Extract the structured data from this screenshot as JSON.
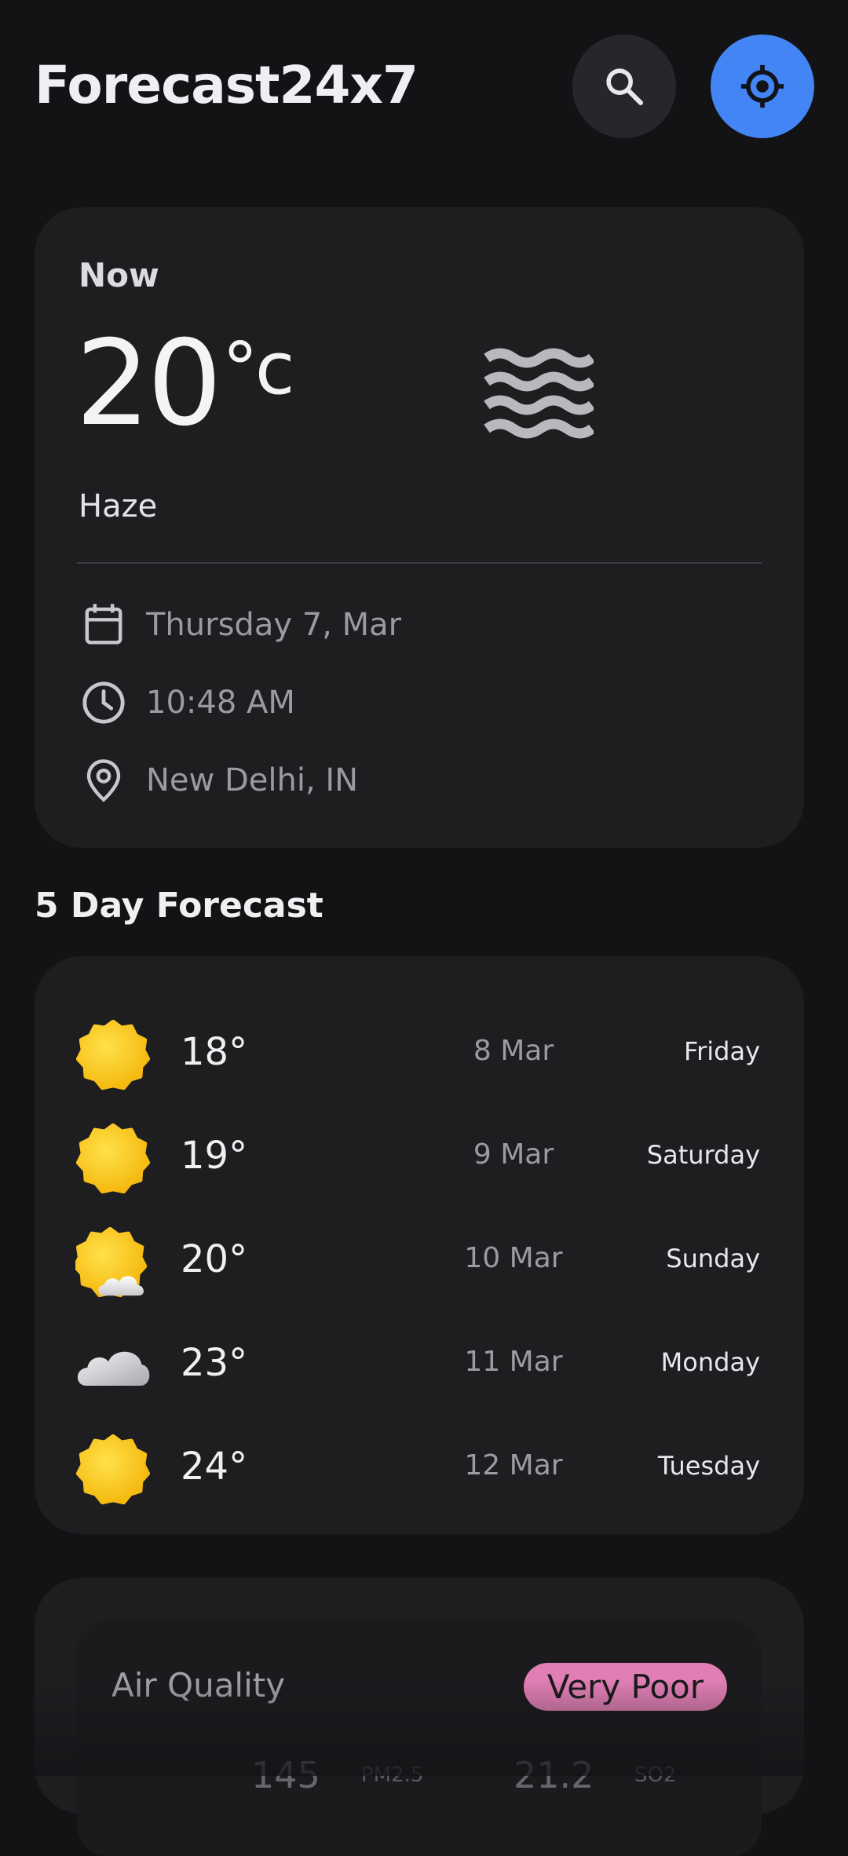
{
  "header": {
    "app_title": "Forecast24x7",
    "search_icon": "search-icon",
    "locate_icon": "my-location-icon",
    "accent_color": "#4385f4"
  },
  "now": {
    "label": "Now",
    "temperature": "20",
    "unit": "°c",
    "condition": "Haze",
    "condition_icon": "haze-icon",
    "date": "Thursday 7, Mar",
    "time": "10:48 AM",
    "location": "New Delhi, IN"
  },
  "forecast": {
    "title": "5 Day Forecast",
    "days": [
      {
        "temp": "18°",
        "date": "8 Mar",
        "day": "Friday",
        "icon": "sun-icon"
      },
      {
        "temp": "19°",
        "date": "9 Mar",
        "day": "Saturday",
        "icon": "sun-icon"
      },
      {
        "temp": "20°",
        "date": "10 Mar",
        "day": "Sunday",
        "icon": "partly-cloudy-icon"
      },
      {
        "temp": "23°",
        "date": "11 Mar",
        "day": "Monday",
        "icon": "cloud-icon"
      },
      {
        "temp": "24°",
        "date": "12 Mar",
        "day": "Tuesday",
        "icon": "sun-icon"
      }
    ]
  },
  "air_quality": {
    "title": "Air Quality",
    "status": "Very Poor",
    "status_color": "#e17fb4",
    "pm25_value": "145",
    "pm25_label": "PM2.5",
    "so2_value": "21.2",
    "so2_label": "SO2"
  }
}
